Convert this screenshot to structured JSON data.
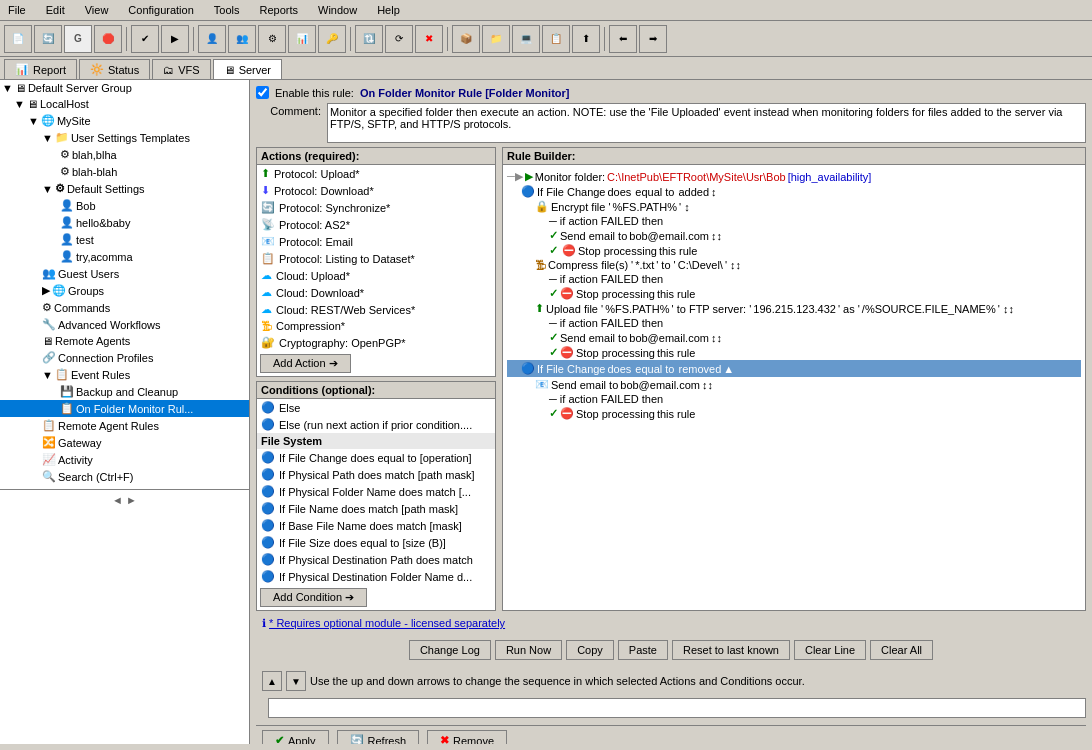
{
  "menubar": {
    "items": [
      "File",
      "Edit",
      "View",
      "Configuration",
      "Tools",
      "Reports",
      "Window",
      "Help"
    ]
  },
  "tabs": {
    "items": [
      "Report",
      "Status",
      "VFS",
      "Server"
    ]
  },
  "sidebar": {
    "tree": [
      {
        "id": "default-server-group",
        "label": "Default Server Group",
        "level": 0,
        "icon": "server-group"
      },
      {
        "id": "localhost",
        "label": "LocalHost",
        "level": 1,
        "icon": "server"
      },
      {
        "id": "mysite",
        "label": "MySite",
        "level": 2,
        "icon": "globe"
      },
      {
        "id": "user-settings-templates",
        "label": "User Settings Templates",
        "level": 3,
        "icon": "folder"
      },
      {
        "id": "blah-blha",
        "label": "blah,blha",
        "level": 4,
        "icon": "gear"
      },
      {
        "id": "blah-blah",
        "label": "blah-blah",
        "level": 4,
        "icon": "gear"
      },
      {
        "id": "default-settings",
        "label": "Default Settings",
        "level": 3,
        "icon": "gear-bold"
      },
      {
        "id": "bob",
        "label": "Bob",
        "level": 4,
        "icon": "user"
      },
      {
        "id": "hello-baby",
        "label": "hello&baby",
        "level": 4,
        "icon": "user"
      },
      {
        "id": "test",
        "label": "test",
        "level": 4,
        "icon": "user"
      },
      {
        "id": "try-acomma",
        "label": "try,acomma",
        "level": 4,
        "icon": "user"
      },
      {
        "id": "guest-users",
        "label": "Guest Users",
        "level": 3,
        "icon": "users"
      },
      {
        "id": "groups",
        "label": "Groups",
        "level": 3,
        "icon": "groups"
      },
      {
        "id": "commands",
        "label": "Commands",
        "level": 3,
        "icon": "commands"
      },
      {
        "id": "advanced-workflows",
        "label": "Advanced Workflows",
        "level": 3,
        "icon": "workflows"
      },
      {
        "id": "remote-agents",
        "label": "Remote Agents",
        "level": 3,
        "icon": "agents"
      },
      {
        "id": "connection-profiles",
        "label": "Connection Profiles",
        "level": 3,
        "icon": "profiles"
      },
      {
        "id": "event-rules",
        "label": "Event Rules",
        "level": 3,
        "icon": "rules"
      },
      {
        "id": "backup-cleanup",
        "label": "Backup and Cleanup",
        "level": 4,
        "icon": "backup"
      },
      {
        "id": "on-folder-monitor-rule",
        "label": "On Folder Monitor Rul...",
        "level": 4,
        "icon": "rule-selected",
        "selected": true
      },
      {
        "id": "remote-agent-rules",
        "label": "Remote Agent Rules",
        "level": 3,
        "icon": "remote-rules"
      },
      {
        "id": "gateway",
        "label": "Gateway",
        "level": 3,
        "icon": "gateway"
      },
      {
        "id": "activity",
        "label": "Activity",
        "level": 3,
        "icon": "activity"
      },
      {
        "id": "search",
        "label": "Search (Ctrl+F)",
        "level": 3,
        "icon": "search"
      }
    ]
  },
  "rule": {
    "enable_label": "Enable this rule:",
    "rule_name": "On Folder Monitor Rule [Folder Monitor]",
    "comment_label": "Comment:",
    "comment_text": "Monitor a specified folder then execute an action. NOTE: use the 'File Uploaded' event instead when monitoring folders for files added to the server via FTP/S, SFTP, and HTTP/S protocols.",
    "actions_header": "Actions (required):",
    "conditions_header": "Conditions (optional):",
    "rule_builder_header": "Rule Builder:",
    "actions": [
      {
        "label": "Protocol: Upload*",
        "icon": "upload"
      },
      {
        "label": "Protocol: Download*",
        "icon": "download"
      },
      {
        "label": "Protocol: Synchronize*",
        "icon": "sync"
      },
      {
        "label": "Protocol: AS2*",
        "icon": "as2"
      },
      {
        "label": "Protocol: Email",
        "icon": "email"
      },
      {
        "label": "Protocol: Listing to Dataset*",
        "icon": "listing"
      },
      {
        "label": "Cloud: Upload*",
        "icon": "cloud-upload"
      },
      {
        "label": "Cloud: Download*",
        "icon": "cloud-download"
      },
      {
        "label": "Cloud: REST/Web Services*",
        "icon": "cloud-rest"
      },
      {
        "label": "Compression*",
        "icon": "compress"
      },
      {
        "label": "Cryptography: OpenPGP*",
        "icon": "crypto"
      }
    ],
    "add_action_label": "Add Action ➔",
    "conditions": [
      {
        "label": "Else",
        "type": "normal"
      },
      {
        "label": "Else (run next action if prior condition....",
        "type": "normal"
      },
      {
        "label": "File System",
        "type": "section"
      },
      {
        "label": "If File Change does equal to [operation]",
        "type": "normal"
      },
      {
        "label": "If Physical Path does match [path mask]",
        "type": "normal"
      },
      {
        "label": "If Physical Folder Name does match [...",
        "type": "normal"
      },
      {
        "label": "If File Name does match [path mask]",
        "type": "normal"
      },
      {
        "label": "If Base File Name does match [mask]",
        "type": "normal"
      },
      {
        "label": "If File Size does equal to [size (B)]",
        "type": "normal"
      },
      {
        "label": "If Physical Destination Path does match",
        "type": "normal"
      },
      {
        "label": "If Physical Destination Folder Name d...",
        "type": "normal"
      }
    ],
    "add_condition_label": "Add Condition ➔",
    "rule_tree": [
      {
        "level": 0,
        "text": "Monitor folder: C:\\InetPub\\EFTRoot\\MySite\\Usr\\Bob",
        "suffix": "[high_availability]",
        "icon": "monitor"
      },
      {
        "level": 1,
        "text": "If File Change",
        "link1": "does",
        "link2": "equal to",
        "link3": "added",
        "icon": "filechange"
      },
      {
        "level": 2,
        "text": "Encrypt file '%FS.PATH%'",
        "icon": "encrypt"
      },
      {
        "level": 3,
        "text": "if action FAILED then",
        "icon": "none"
      },
      {
        "level": 3,
        "text": "Send email to",
        "link1": "bob@email.com",
        "icon": "send"
      },
      {
        "level": 3,
        "text": "Stop processing",
        "link1": "this rule",
        "icon": "stop"
      },
      {
        "level": 2,
        "text": "Compress file(s) '*.txt' to 'C:\\Devel\\'",
        "icon": "compress2"
      },
      {
        "level": 3,
        "text": "if action FAILED then",
        "icon": "none"
      },
      {
        "level": 3,
        "text": "Stop processing",
        "link1": "this rule",
        "icon": "stop"
      },
      {
        "level": 2,
        "text": "Upload file '%FS.PATH%' to FTP server: '196.215.123.432' as '/%SOURCE.FILE_NAME%'",
        "icon": "ftp"
      },
      {
        "level": 3,
        "text": "if action FAILED then",
        "icon": "none"
      },
      {
        "level": 3,
        "text": "Send email to",
        "link1": "bob@email.com",
        "icon": "send"
      },
      {
        "level": 3,
        "text": "Stop processing",
        "link1": "this rule",
        "icon": "stop"
      },
      {
        "level": 1,
        "text": "If File Change",
        "link1": "does",
        "link2": "equal to",
        "link3": "removed",
        "icon": "filechange",
        "selected": true
      },
      {
        "level": 2,
        "text": "Send email to",
        "link1": "bob@email.com",
        "icon": "send"
      },
      {
        "level": 3,
        "text": "if action FAILED then",
        "icon": "none"
      },
      {
        "level": 3,
        "text": "Stop processing",
        "link1": "this rule",
        "icon": "stop"
      }
    ],
    "info_text": "* Requires optional module - licensed separately",
    "buttons": {
      "change_log": "Change Log",
      "run_now": "Run Now",
      "copy": "Copy",
      "paste": "Paste",
      "reset_last_known": "Reset to last known",
      "clear_line": "Clear Line",
      "clear_all": "Clear All"
    },
    "seq_note": "Use the up and down arrows to change the sequence in which selected Actions and Conditions occur.",
    "apply": "Apply",
    "refresh": "Refresh",
    "remove": "Remove"
  }
}
